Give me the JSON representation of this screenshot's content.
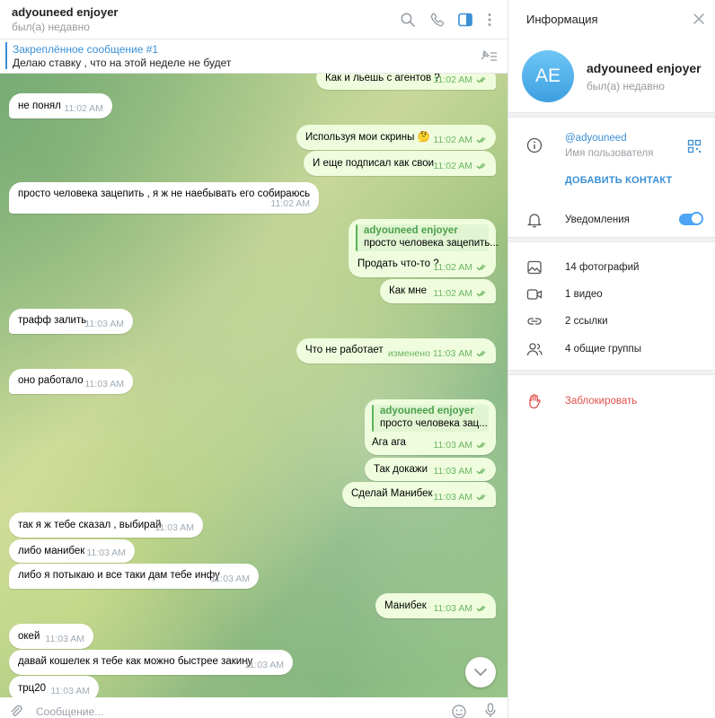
{
  "chat": {
    "title": "adyouneed enjoyer",
    "status": "был(а) недавно",
    "pinned": {
      "title": "Закреплённое сообщение #1",
      "text": "Делаю ставку , что на этой неделе не будет"
    },
    "input_placeholder": "Сообщение...",
    "messages": [
      {
        "dir": "out",
        "text": "Как и льешь с агентов ?",
        "time": "11:02 AM"
      },
      {
        "dir": "in",
        "text": "не понял",
        "time": "11:02 AM"
      },
      {
        "dir": "out",
        "text": "Используя мои скрины 🤔",
        "time": "11:02 AM"
      },
      {
        "dir": "out",
        "text": "И еще подписал как свои",
        "time": "11:02 AM"
      },
      {
        "dir": "in",
        "text": "просто человека зацепить , я ж не наебывать его собираюсь",
        "time": "11:02 AM"
      },
      {
        "dir": "out",
        "reply_name": "adyouneed enjoyer",
        "reply_text": "просто человека зацепить...",
        "text": "Продать что-то ?",
        "time": "11:02 AM"
      },
      {
        "dir": "out",
        "text": "Как мне",
        "time": "11:02 AM"
      },
      {
        "dir": "in",
        "text": "трафф залить",
        "time": "11:03 AM"
      },
      {
        "dir": "out",
        "text": "Что не работает",
        "time": "изменено 11:03 AM"
      },
      {
        "dir": "in",
        "text": "оно работало",
        "time": "11:03 AM"
      },
      {
        "dir": "out",
        "reply_name": "adyouneed enjoyer",
        "reply_text": "просто человека зац...",
        "text": "Ага ага",
        "time": "11:03 AM"
      },
      {
        "dir": "out",
        "text": "Так докажи",
        "time": "11:03 AM"
      },
      {
        "dir": "out",
        "text": "Сделай Манибек",
        "time": "11:03 AM"
      },
      {
        "dir": "in",
        "text": "так я ж тебе сказал , выбирай",
        "time": "11:03 AM"
      },
      {
        "dir": "in",
        "text": "либо манибек",
        "time": "11:03 AM"
      },
      {
        "dir": "in",
        "text": "либо я потыкаю и все таки дам тебе инфу",
        "time": "11:03 AM"
      },
      {
        "dir": "out",
        "text": "Манибек",
        "time": "11:03 AM"
      },
      {
        "dir": "in",
        "text": "окей",
        "time": "11:03 AM"
      },
      {
        "dir": "in",
        "text": "давай кошелек я тебе как можно быстрее закину",
        "time": "11:03 AM"
      },
      {
        "dir": "in",
        "text": "трц20",
        "time": "11:03 AM"
      }
    ]
  },
  "info": {
    "title": "Информация",
    "avatar_initials": "AE",
    "name": "adyouneed enjoyer",
    "status": "был(а) недавно",
    "username": "@adyouneed",
    "username_label": "Имя пользователя",
    "add_contact": "ДОБАВИТЬ КОНТАКТ",
    "notifications_label": "Уведомления",
    "notifications_on": true,
    "media": {
      "photos": "14 фотографий",
      "videos": "1 видео",
      "links": "2 ссылки",
      "groups": "4 общие группы"
    },
    "block": "Заблокировать"
  },
  "colors": {
    "accent": "#3a8fd6",
    "outgoing_bubble": "#effdde",
    "incoming_bubble": "#ffffff",
    "danger": "#e0524e",
    "read_check": "#6cb563"
  }
}
